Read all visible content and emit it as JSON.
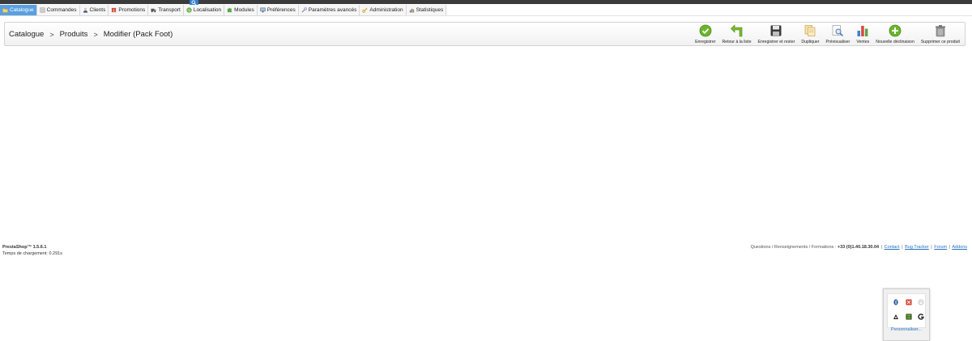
{
  "menu": {
    "items": [
      {
        "label": "Catalogue",
        "icon": "folder-icon",
        "active": true
      },
      {
        "label": "Commandes",
        "icon": "orders-icon"
      },
      {
        "label": "Clients",
        "icon": "customer-icon"
      },
      {
        "label": "Promotions",
        "icon": "promotions-icon"
      },
      {
        "label": "Transport",
        "icon": "truck-icon"
      },
      {
        "label": "Localisation",
        "icon": "globe-icon"
      },
      {
        "label": "Modules",
        "icon": "puzzle-icon"
      },
      {
        "label": "Préférences",
        "icon": "monitor-icon"
      },
      {
        "label": "Paramètres avancés",
        "icon": "wrench-icon"
      },
      {
        "label": "Administration",
        "icon": "key-icon"
      },
      {
        "label": "Statistiques",
        "icon": "stats-icon"
      }
    ]
  },
  "breadcrumb": {
    "items": [
      "Catalogue",
      "Produits",
      "Modifier (Pack Foot)"
    ],
    "separator": ">"
  },
  "toolbar": {
    "buttons": [
      {
        "label": "Enregistrer",
        "icon": "check-icon"
      },
      {
        "label": "Retour à la liste",
        "icon": "back-arrow-icon"
      },
      {
        "label": "Enregistrer et rester",
        "icon": "save-disk-icon"
      },
      {
        "label": "Dupliquer",
        "icon": "duplicate-icon"
      },
      {
        "label": "Prévisualiser",
        "icon": "preview-icon"
      },
      {
        "label": "Ventes",
        "icon": "sales-chart-icon"
      },
      {
        "label": "Nouvelle déclinaison",
        "icon": "add-icon"
      },
      {
        "label": "Supprimer ce produit",
        "icon": "trash-icon"
      }
    ]
  },
  "footer": {
    "version": "PrestaShop™ 1.5.6.1",
    "load_time": "Temps de chargement: 0.291s",
    "support_text": "Questions / Renseignements / Formations :",
    "phone": "+33 (0)1.40.18.30.04",
    "links": [
      "Contact",
      "Bug Tracker",
      "Forum",
      "Addons"
    ]
  },
  "widget": {
    "icons": [
      "bluetooth-icon",
      "bookmark-icon",
      "cloud-icon",
      "user-icon",
      "grid-icon",
      "g-icon"
    ],
    "link_label": "Personnaliser..."
  },
  "colors": {
    "active_menu": "#5aa0e0",
    "link": "#1f6fbf",
    "top_strip": "#3b3b3b"
  }
}
